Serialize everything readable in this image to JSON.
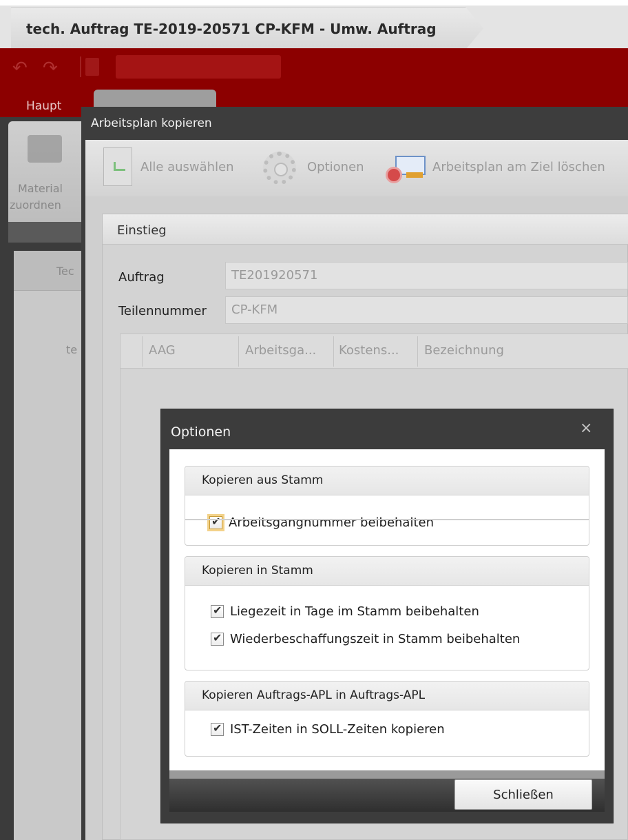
{
  "window": {
    "title": "tech. Auftrag TE-2019-20571 CP-KFM - Umw. Auftrag"
  },
  "ribbon": {
    "tab_haupt": "Haupt"
  },
  "left_panel": {
    "card_label_line1": "Material",
    "card_label_line2": "zuordnen",
    "tree_label_1": "Tec",
    "tree_label_2": "te"
  },
  "copy_window": {
    "title": "Arbeitsplan kopieren",
    "toolbar": {
      "select_all": "Alle auswählen",
      "options": "Optionen",
      "delete_target": "Arbeitsplan am Ziel löschen"
    },
    "section_title": "Einstieg",
    "fields": {
      "auftrag_label": "Auftrag",
      "auftrag_value": "TE201920571",
      "teilennummer_label": "Teilennummer",
      "teilennummer_value": "CP-KFM"
    },
    "grid_columns": [
      "AAG",
      "Arbeitsga...",
      "Kostens...",
      "Bezeichnung"
    ]
  },
  "options_dialog": {
    "title": "Optionen",
    "close_symbol": "×",
    "groups": [
      {
        "title": "Kopieren aus Stamm",
        "options": [
          {
            "label": "Arbeitsgangnummer beibehalten",
            "checked": true
          }
        ]
      },
      {
        "title": "Kopieren in Stamm",
        "options": [
          {
            "label": "Liegezeit in Tage im Stamm beibehalten",
            "checked": true
          },
          {
            "label": "Wiederbeschaffungszeit in Stamm beibehalten",
            "checked": true
          }
        ]
      },
      {
        "title": "Kopieren Auftrags-APL in Auftrags-APL",
        "options": [
          {
            "label": "IST-Zeiten in SOLL-Zeiten kopieren",
            "checked": true
          }
        ]
      }
    ],
    "close_button": "Schließen"
  },
  "colors": {
    "ribbon_red": "#8c0000",
    "dialog_frame": "#3c3c3c",
    "focus_highlight": "#f3d28a"
  }
}
